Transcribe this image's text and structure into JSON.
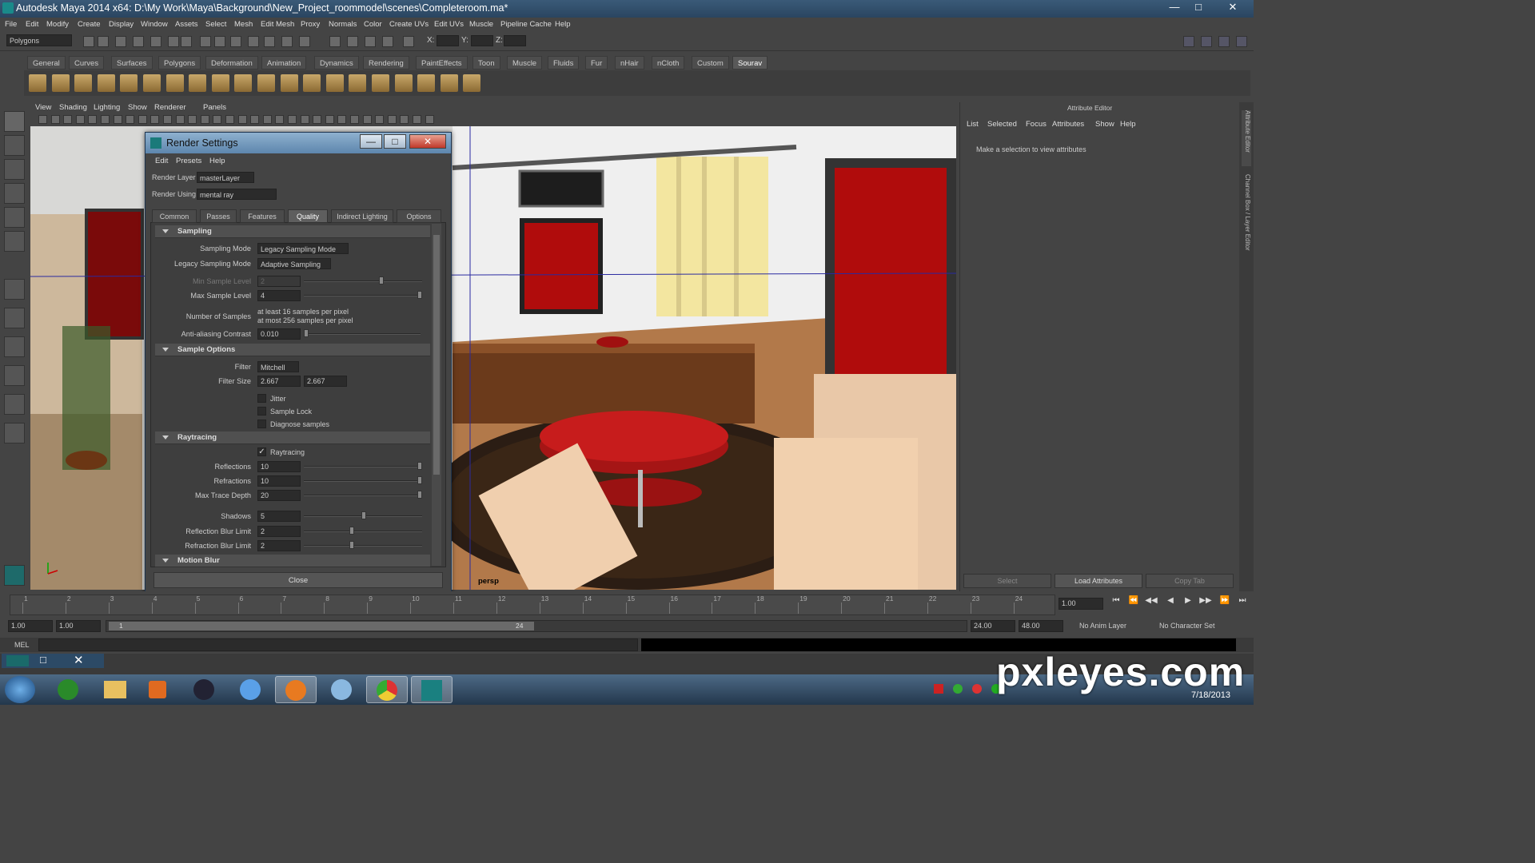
{
  "window": {
    "title": "Autodesk Maya 2014 x64: D:\\My Work\\Maya\\Background\\New_Project_roommodel\\scenes\\Completeroom.ma*"
  },
  "menubar": [
    "File",
    "Edit",
    "Modify",
    "Create",
    "Display",
    "Window",
    "Assets",
    "Select",
    "Mesh",
    "Edit Mesh",
    "Proxy",
    "Normals",
    "Color",
    "Create UVs",
    "Edit UVs",
    "Muscle",
    "Pipeline Cache",
    "Help"
  ],
  "toolbar": {
    "mode": "Polygons",
    "x_label": "X:",
    "y_label": "Y:",
    "z_label": "Z:"
  },
  "shelf_tabs": [
    "General",
    "Curves",
    "Surfaces",
    "Polygons",
    "Deformation",
    "Animation",
    "Dynamics",
    "Rendering",
    "PaintEffects",
    "Toon",
    "Muscle",
    "Fluids",
    "Fur",
    "nHair",
    "nCloth",
    "Custom",
    "Sourav"
  ],
  "shelf_active": "Sourav",
  "viewport": {
    "menu": [
      "View",
      "Shading",
      "Lighting",
      "Show",
      "Renderer",
      "Panels"
    ],
    "camera": "persp"
  },
  "attribute_editor": {
    "title": "Attribute Editor",
    "menu": [
      "List",
      "Selected",
      "Focus",
      "Attributes",
      "Show",
      "Help"
    ],
    "message": "Make a selection to view attributes",
    "buttons": {
      "select": "Select",
      "load": "Load Attributes",
      "copy": "Copy Tab"
    },
    "side_tabs": [
      "Attribute Editor",
      "Channel Box / Layer Editor"
    ]
  },
  "render_settings": {
    "title": "Render Settings",
    "menu": [
      "Edit",
      "Presets",
      "Help"
    ],
    "render_layer_label": "Render Layer",
    "render_layer": "masterLayer",
    "render_using_label": "Render Using",
    "render_using": "mental ray",
    "tabs": [
      "Common",
      "Passes",
      "Features",
      "Quality",
      "Indirect Lighting",
      "Options"
    ],
    "active_tab": "Quality",
    "sampling": {
      "header": "Sampling",
      "sampling_mode_label": "Sampling Mode",
      "sampling_mode": "Legacy Sampling Mode",
      "legacy_label": "Legacy Sampling Mode",
      "legacy": "Adaptive Sampling",
      "min_label": "Min Sample Level",
      "min": "2",
      "max_label": "Max Sample Level",
      "max": "4",
      "num_label": "Number of Samples",
      "num_line1": "at least 16 samples per pixel",
      "num_line2": "at most 256 samples per pixel",
      "aa_label": "Anti-aliasing Contrast",
      "aa": "0.010"
    },
    "sample_options": {
      "header": "Sample Options",
      "filter_label": "Filter",
      "filter": "Mitchell",
      "filter_size_label": "Filter Size",
      "fs1": "2.667",
      "fs2": "2.667",
      "jitter": "Jitter",
      "sample_lock": "Sample Lock",
      "diagnose": "Diagnose samples"
    },
    "raytracing": {
      "header": "Raytracing",
      "raytracing": "Raytracing",
      "reflections_label": "Reflections",
      "reflections": "10",
      "refractions_label": "Refractions",
      "refractions": "10",
      "depth_label": "Max Trace Depth",
      "depth": "20",
      "shadows_label": "Shadows",
      "shadows": "5",
      "refl_blur_label": "Reflection Blur Limit",
      "refl_blur": "2",
      "refr_blur_label": "Refraction Blur Limit",
      "refr_blur": "2"
    },
    "motion_blur": {
      "header": "Motion Blur"
    },
    "close": "Close"
  },
  "timeline": {
    "ticks": [
      "1",
      "2",
      "3",
      "4",
      "5",
      "6",
      "7",
      "8",
      "9",
      "10",
      "11",
      "12",
      "13",
      "14",
      "15",
      "16",
      "17",
      "18",
      "19",
      "20",
      "21",
      "22",
      "23",
      "24"
    ],
    "current": "1.00"
  },
  "range": {
    "start1": "1.00",
    "start2": "1.00",
    "slider_start": "1",
    "slider_end": "24",
    "end1": "24.00",
    "end2": "48.00",
    "anim_layer": "No Anim Layer",
    "char_set": "No Character Set"
  },
  "cmdline": {
    "label": "MEL"
  },
  "taskbar": {
    "date": "7/18/2013"
  },
  "watermark": "pxleyes.com"
}
